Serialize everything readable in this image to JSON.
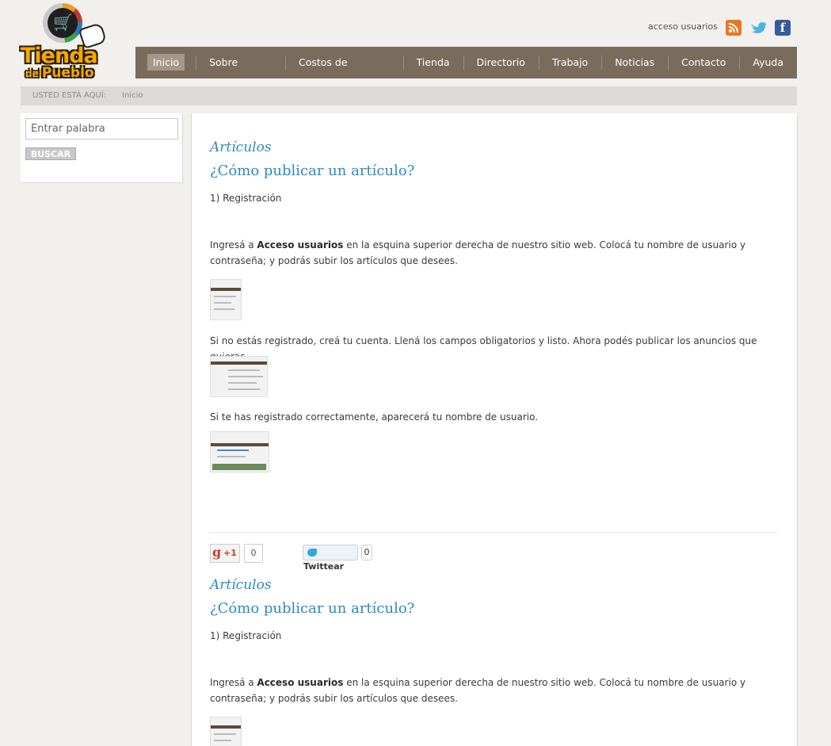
{
  "site": {
    "logo_text_line1": "Tienda",
    "logo_text_line2_small": "del",
    "logo_text_line2": "Pueblo"
  },
  "header": {
    "access_link": "acceso usuarios",
    "rss_icon": "rss-icon",
    "twitter_icon": "twitter-icon",
    "facebook_icon": "facebook-icon"
  },
  "nav": {
    "items": [
      {
        "label": "Inicio",
        "active": true
      },
      {
        "label": "Sobre nosotros"
      },
      {
        "label": "Costos de Publicación"
      },
      {
        "label": "Tienda"
      },
      {
        "label": "Directorio"
      },
      {
        "label": "Trabajo"
      },
      {
        "label": "Noticias"
      },
      {
        "label": "Contacto"
      },
      {
        "label": "Ayuda"
      }
    ]
  },
  "breadcrumb": {
    "label": "USTED ESTÁ AQUÍ:",
    "current": "Inicio"
  },
  "sidebar": {
    "search_placeholder": "Entrar palabra",
    "search_button": "BUSCAR"
  },
  "articles": [
    {
      "category": "Artículos",
      "title": "¿Cómo publicar un artículo?",
      "step": "1) Registración",
      "p1_pre": "Ingresá a ",
      "p1_bold": "Acceso usuarios",
      "p1_post": " en la esquina superior derecha de nuestro sitio web. Colocá tu nombre de usuario y contraseña; y podrás subir los artículos que desees.",
      "p2": "Si no estás registrado, creá tu cuenta. Llená los campos obligatorios y listo. Ahora podés publicar los anuncios que quieras.",
      "p3": "Si te has registrado correctamente, aparecerá tu nombre de usuario."
    },
    {
      "category": "Artículos",
      "title": "¿Cómo publicar un artículo?",
      "step": "1) Registración",
      "p1_pre": "Ingresá a ",
      "p1_bold": "Acceso usuarios",
      "p1_post": " en la esquina superior derecha de nuestro sitio web. Colocá tu nombre de usuario y contraseña; y podrás subir los artículos que desees."
    }
  ],
  "share": {
    "gplus_g": "g",
    "gplus_label": "+1",
    "gplus_count": "0",
    "tweet_label": "Twittear",
    "tweet_count": "0"
  }
}
